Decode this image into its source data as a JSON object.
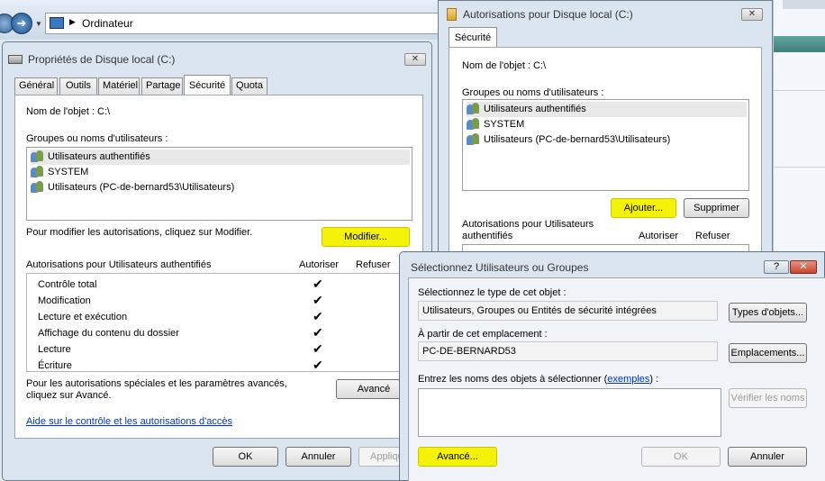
{
  "explorer": {
    "address": "Ordinateur"
  },
  "props": {
    "title": "Propriétés de Disque local (C:)",
    "tabs": [
      "Général",
      "Outils",
      "Matériel",
      "Partage",
      "Sécurité",
      "Quota"
    ],
    "object_label": "Nom de l'objet :",
    "object_value": "C:\\",
    "groups_label": "Groupes ou noms d'utilisateurs :",
    "users": [
      "Utilisateurs authentifiés",
      "SYSTEM",
      "Utilisateurs (PC-de-bernard53\\Utilisateurs)"
    ],
    "modify_hint": "Pour modifier les autorisations, cliquez sur Modifier.",
    "modify_button": "Modifier...",
    "perm_header": "Autorisations pour Utilisateurs authentifiés",
    "col_allow": "Autoriser",
    "col_deny": "Refuser",
    "permissions": [
      "Contrôle total",
      "Modification",
      "Lecture et exécution",
      "Affichage du contenu du dossier",
      "Lecture",
      "Écriture"
    ],
    "check": "✔",
    "special_text": "Pour les autorisations spéciales et les paramètres avancés, cliquez sur Avancé.",
    "advanced_button": "Avancé",
    "help_link": "Aide sur le contrôle et les autorisations d'accès",
    "ok": "OK",
    "cancel": "Annuler",
    "apply": "Appliqu"
  },
  "auth": {
    "title": "Autorisations pour Disque local (C:)",
    "tab": "Sécurité",
    "object_label": "Nom de l'objet :",
    "object_value": "C:\\",
    "groups_label": "Groupes ou noms d'utilisateurs :",
    "users": [
      "Utilisateurs authentifiés",
      "SYSTEM",
      "Utilisateurs (PC-de-bernard53\\Utilisateurs)"
    ],
    "add_button": "Ajouter...",
    "remove_button": "Supprimer",
    "perm_header_1": "Autorisations pour Utilisateurs",
    "perm_header_2": "authentifiés",
    "col_allow": "Autoriser",
    "col_deny": "Refuser"
  },
  "select": {
    "title": "Sélectionnez Utilisateurs ou Groupes",
    "help_glyph": "?",
    "close_glyph": "✕",
    "type_label": "Sélectionnez le type de cet objet :",
    "type_value": "Utilisateurs, Groupes ou Entités de sécurité intégrées",
    "types_button": "Types d'objets...",
    "location_label": "À partir de cet emplacement :",
    "location_value": "PC-DE-BERNARD53",
    "locations_button": "Emplacements...",
    "names_label": "Entrez les noms des objets à sélectionner (",
    "names_link": "exemples",
    "names_label_end": ") :",
    "check_names": "Vérifier les noms",
    "advanced_button": "Avancé...",
    "ok": "OK",
    "cancel": "Annuler"
  },
  "colors": {
    "highlight": "#f5f20a",
    "link": "#0033cc",
    "close_red": "#c9452f"
  }
}
